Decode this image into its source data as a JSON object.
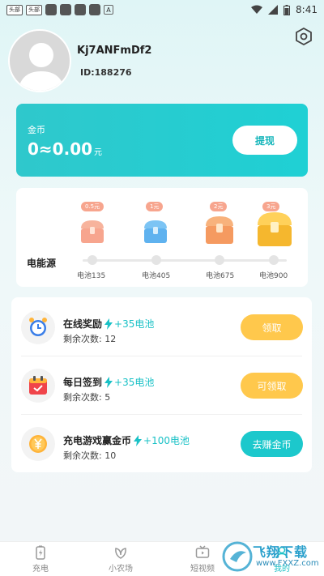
{
  "status_bar": {
    "left_chips": [
      "头部",
      "头部"
    ],
    "time": "8:41"
  },
  "profile": {
    "username": "Kj7ANFmDf2",
    "user_id": "ID:188276"
  },
  "coins": {
    "label": "金币",
    "value": "0≈0.00",
    "unit": "元",
    "withdraw_label": "提现"
  },
  "battery": {
    "label": "电能源",
    "milestones": [
      {
        "reward": "0.5元",
        "caption": "电池135",
        "color": "#f7a58e"
      },
      {
        "reward": "1元",
        "caption": "电池405",
        "color": "#5fb2ef"
      },
      {
        "reward": "2元",
        "caption": "电池675",
        "color": "#f59a60"
      },
      {
        "reward": "3元",
        "caption": "电池900",
        "color": "#f5b72e"
      }
    ]
  },
  "tasks": [
    {
      "title": "在线奖励",
      "reward": "+35电池",
      "count": "剩余次数: 12",
      "button": "领取",
      "button_style": "yellow",
      "icon": "alarm-clock-icon"
    },
    {
      "title": "每日签到",
      "reward": "+35电池",
      "count": "剩余次数: 5",
      "button": "可领取",
      "button_style": "yellow",
      "icon": "calendar-icon"
    },
    {
      "title": "充电游戏赢金币",
      "reward": "+100电池",
      "count": "剩余次数: 10",
      "button": "去赚金币",
      "button_style": "teal",
      "icon": "yuan-coin-icon"
    }
  ],
  "nav": {
    "items": [
      {
        "label": "充电",
        "icon": "battery-icon"
      },
      {
        "label": "小农场",
        "icon": "leaf-icon"
      },
      {
        "label": "短视频",
        "icon": "tv-icon"
      },
      {
        "label": "我的",
        "icon": "user-icon"
      }
    ]
  },
  "watermark": {
    "text": "飞翔下载",
    "url": "www.FXXZ.com"
  },
  "colors": {
    "accent": "#1cc8cc",
    "yellow_button": "#ffc84c"
  }
}
